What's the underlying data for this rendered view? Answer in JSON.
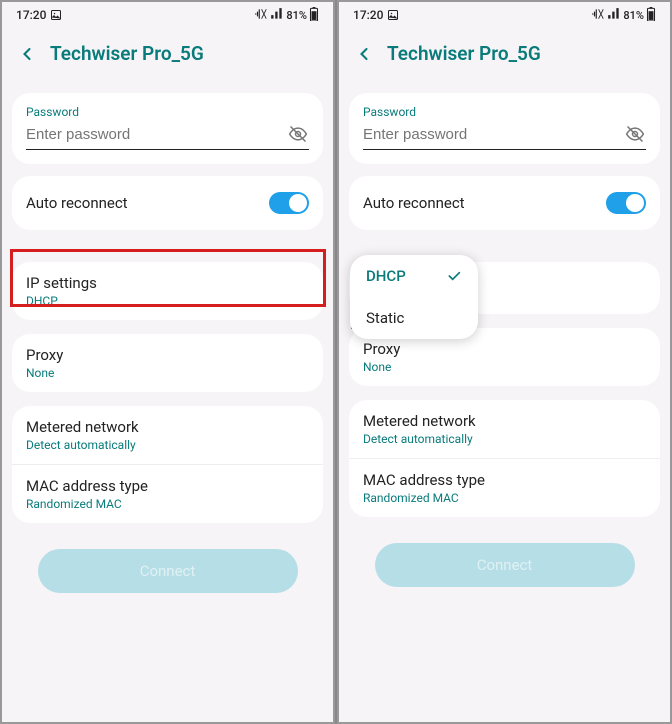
{
  "status": {
    "time": "17:20",
    "battery": "81%"
  },
  "header": {
    "title": "Techwiser Pro_5G"
  },
  "password": {
    "label": "Password",
    "placeholder": "Enter password"
  },
  "autoReconnect": {
    "label": "Auto reconnect"
  },
  "ipSettings": {
    "title": "IP settings",
    "value": "DHCP"
  },
  "proxy": {
    "title": "Proxy",
    "value": "None"
  },
  "metered": {
    "title": "Metered network",
    "value": "Detect automatically"
  },
  "mac": {
    "title": "MAC address type",
    "value": "Randomized MAC"
  },
  "connect": {
    "label": "Connect"
  },
  "dropdown": {
    "option1": "DHCP",
    "option2": "Static"
  }
}
